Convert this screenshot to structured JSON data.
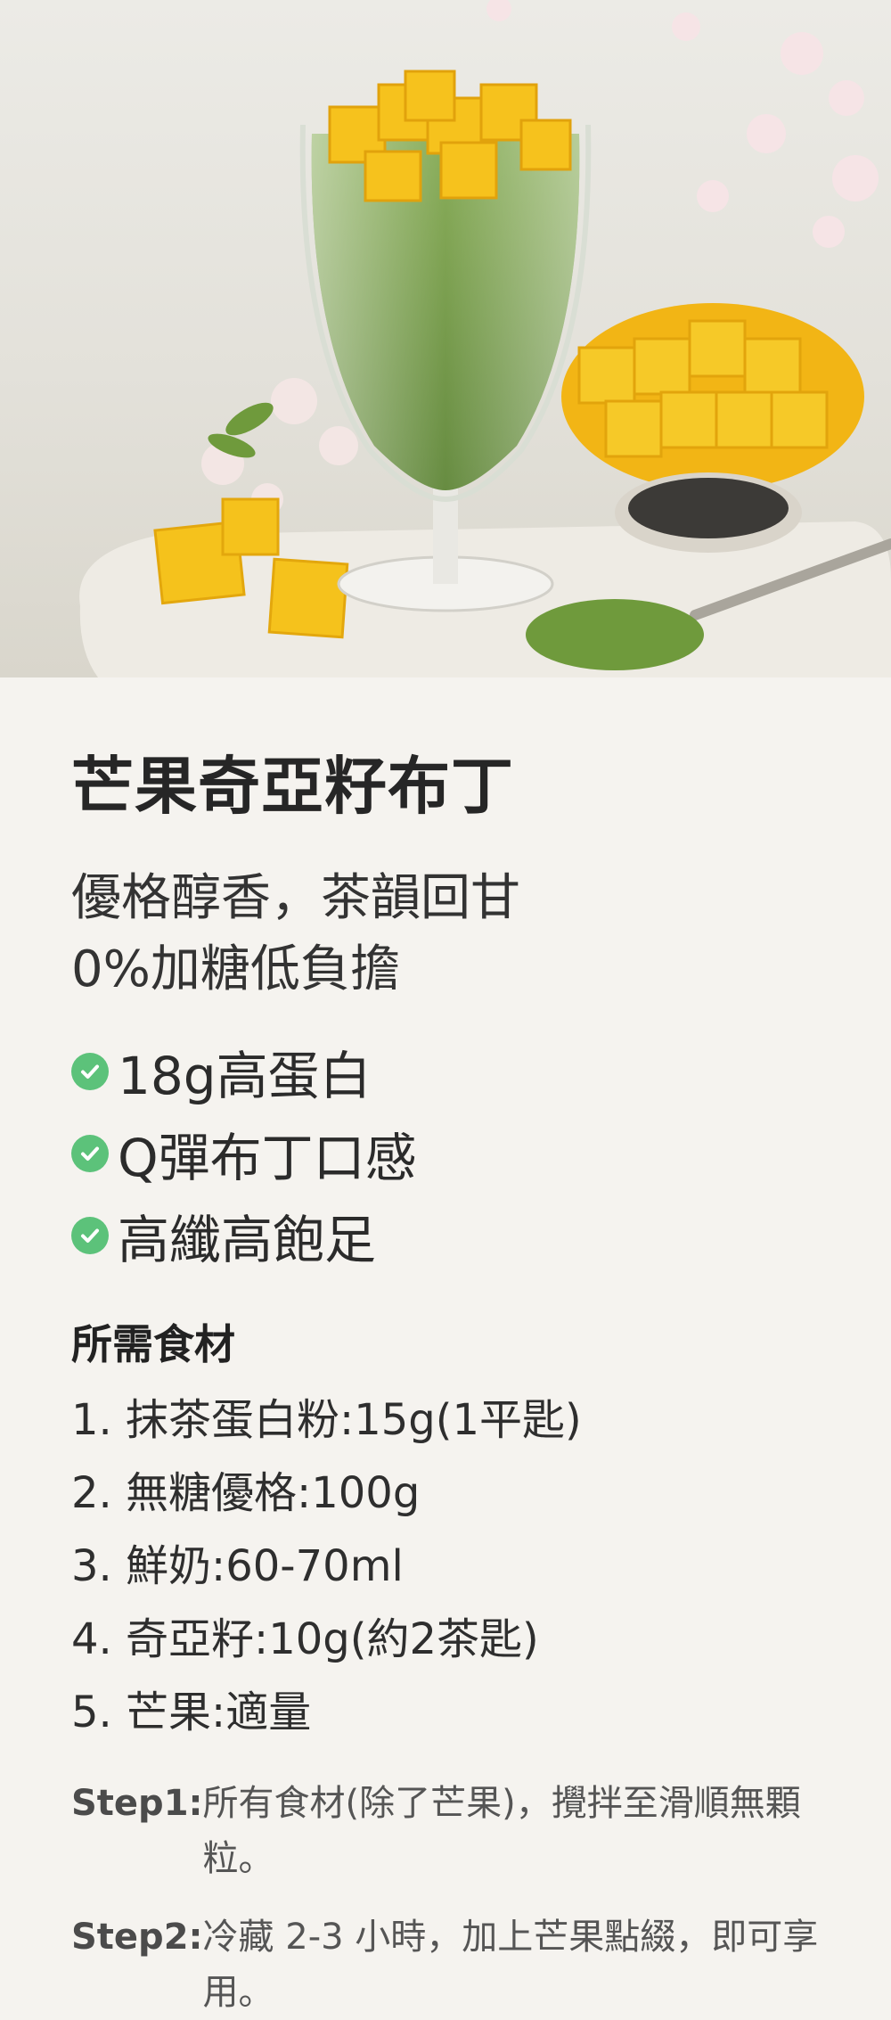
{
  "hero": {
    "alt": "芒果奇亞籽布丁"
  },
  "recipe": {
    "title": "芒果奇亞籽布丁",
    "subtitle_line1": "優格醇香，茶韻回甘",
    "subtitle_line2": "0%加糖低負擔",
    "features": [
      "18g高蛋白",
      "Q彈布丁口感",
      "高纖高飽足"
    ],
    "ingredients_title": "所需食材",
    "ingredients": [
      "1. 抹茶蛋白粉:15g(1平匙)",
      "2. 無糖優格:100g",
      "3. 鮮奶:60-70ml",
      "4. 奇亞籽:10g(約2茶匙)",
      "5. 芒果:適量"
    ],
    "steps": [
      {
        "label": "Step1:",
        "text": "所有食材(除了芒果)，攪拌至滑順無顆粒。"
      },
      {
        "label": "Step2:",
        "text": "冷藏 2-3 小時，加上芒果點綴，即可享用。"
      }
    ]
  },
  "colors": {
    "background": "#f5f3ef",
    "check": "#5cc27a",
    "matcha": "#6f9a3c",
    "mango": "#f4c21a"
  },
  "icons": {
    "feature": "check-circle-icon"
  }
}
